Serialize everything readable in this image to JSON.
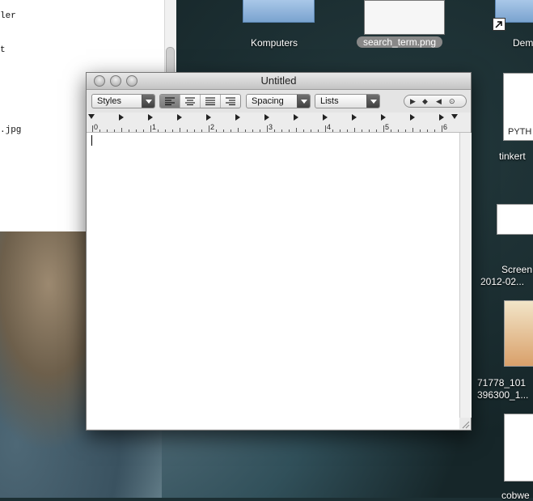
{
  "background_window": {
    "lines": [
      "ler",
      "t",
      ".jpg"
    ]
  },
  "desktop": {
    "icons": [
      {
        "label": "Komputers"
      },
      {
        "label": "search_term.png"
      },
      {
        "label": "Dem"
      },
      {
        "label": "PYTH"
      },
      {
        "label": "tinkert"
      },
      {
        "label": "Screen"
      },
      {
        "label": "2012-02..."
      },
      {
        "label": "71778_101"
      },
      {
        "label": "396300_1..."
      },
      {
        "label": "cobwe"
      }
    ]
  },
  "textedit": {
    "title": "Untitled",
    "styles_popup": "Styles",
    "spacing_popup": "Spacing",
    "lists_popup": "Lists",
    "ruler_numbers": [
      "0",
      "1",
      "2",
      "3",
      "4",
      "5",
      "6"
    ]
  },
  "colors": {
    "accent_selected_label": "#888888",
    "window_chrome": "#e9e9e9"
  }
}
